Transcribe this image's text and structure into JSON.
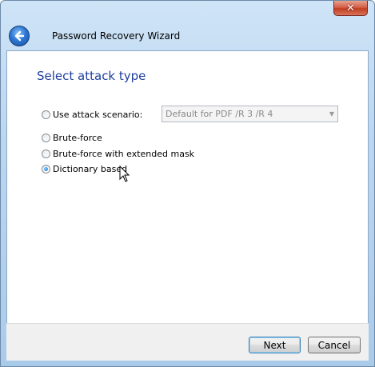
{
  "window": {
    "title": "Password Recovery Wizard",
    "close_glyph": "✕"
  },
  "page": {
    "heading": "Select attack type"
  },
  "options": [
    {
      "label": "Use attack scenario:",
      "selected": false
    },
    {
      "label": "Brute-force",
      "selected": false
    },
    {
      "label": "Brute-force with extended mask",
      "selected": false
    },
    {
      "label": "Dictionary based",
      "selected": true
    }
  ],
  "scenario_select": {
    "value": "Default for PDF /R 3 /R 4",
    "enabled": false
  },
  "buttons": {
    "next_label": "Next",
    "cancel_label": "Cancel"
  },
  "icons": {
    "back": "back-arrow-icon",
    "close": "close-icon",
    "cursor": "mouse-pointer-icon"
  },
  "colors": {
    "heading": "#1e3f9c",
    "frame": "#a9cbea"
  }
}
